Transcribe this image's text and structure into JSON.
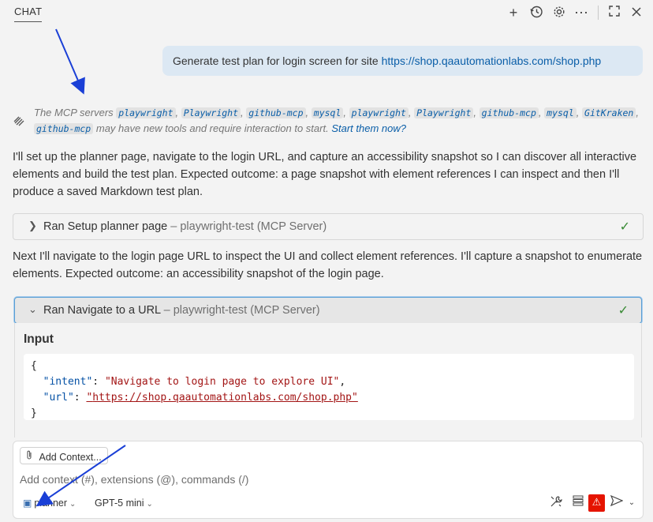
{
  "header": {
    "tab_label": "CHAT",
    "icons": [
      "plus-icon",
      "history-icon",
      "gear-icon",
      "more-icon",
      "maximize-icon",
      "close-icon"
    ]
  },
  "user_message": {
    "text": "Generate test plan for login screen for site ",
    "link": "https://shop.qaautomationlabs.com/shop.php"
  },
  "mcp_notice": {
    "prefix": "The MCP servers",
    "servers": [
      "playwright",
      "Playwright",
      "github-mcp",
      "mysql",
      "playwright",
      "Playwright",
      "github-mcp",
      "mysql",
      "GitKraken",
      "github-mcp"
    ],
    "suffix": "may have new tools and require interaction to start.",
    "link": "Start them now?"
  },
  "paragraph1": "I'll set up the planner page, navigate to the login URL, and capture an accessibility snapshot so I can discover all interactive elements and build the test plan. Expected outcome: a page snapshot with element references I can inspect and then I'll produce a saved Markdown test plan.",
  "tool1": {
    "title": "Ran Setup planner page",
    "source": " – playwright-test (MCP Server)"
  },
  "paragraph2": "Next I'll navigate to the login page URL to inspect the UI and collect element references. I'll capture a snapshot to enumerate elements. Expected outcome: an accessibility snapshot of the login page.",
  "tool2": {
    "title": "Ran Navigate to a URL",
    "source": " – playwright-test (MCP Server)",
    "input_heading": "Input",
    "input": {
      "intent": "Navigate to login page to explore UI",
      "url": "https://shop.qaautomationlabs.com/shop.php"
    }
  },
  "composer": {
    "add_context_label": "Add Context...",
    "placeholder": "Add context (#), extensions (@), commands (/)",
    "mode": "planner",
    "model": "GPT-5 mini"
  },
  "colors": {
    "accent": "#0a5ea8",
    "user_bubble": "#dce8f3",
    "success": "#388a34",
    "warning": "#e51400",
    "annotation_arrow": "#1a3fd6"
  }
}
